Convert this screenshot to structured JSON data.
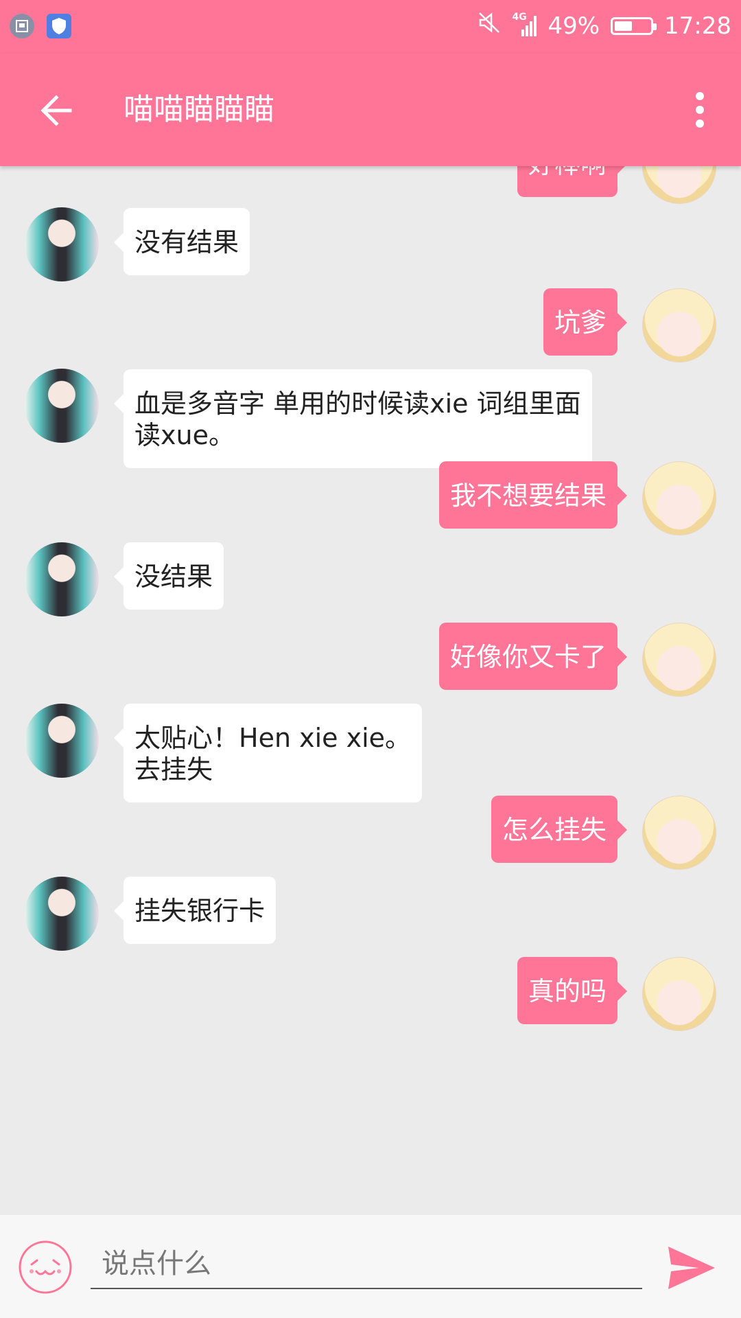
{
  "status_bar": {
    "signal": "4G",
    "battery": "49%",
    "battery_level": 0.49,
    "time": "17:28",
    "icons": [
      "screenshot-icon",
      "shield-icon",
      "mute-icon",
      "signal-icon",
      "battery-icon"
    ]
  },
  "toolbar": {
    "title": "喵喵瞄瞄瞄",
    "icons": [
      "back-arrow-icon",
      "more-vert-icon"
    ]
  },
  "messages": [
    {
      "from": "me",
      "text": "好棒啊"
    },
    {
      "from": "other",
      "text": "没有结果"
    },
    {
      "from": "me",
      "text": "坑爹"
    },
    {
      "from": "other",
      "text": "血是多音字 单用的时候读xie 词组里面\n读xue。"
    },
    {
      "from": "me",
      "text": "我不想要结果"
    },
    {
      "from": "other",
      "text": "没结果"
    },
    {
      "from": "me",
      "text": "好像你又卡了"
    },
    {
      "from": "other",
      "text": "太贴心！Hen xie xie。\n去挂失"
    },
    {
      "from": "me",
      "text": "怎么挂失"
    },
    {
      "from": "other",
      "text": "挂失银行卡"
    },
    {
      "from": "me",
      "text": "真的吗"
    }
  ],
  "input": {
    "placeholder": "说点什么",
    "value": "",
    "icons": [
      "emoji-face-icon",
      "send-icon"
    ]
  },
  "colors": {
    "accent": "#ff7597",
    "background": "#ebebeb",
    "incoming_bubble": "#ffffff",
    "outgoing_text": "#ffffff"
  }
}
